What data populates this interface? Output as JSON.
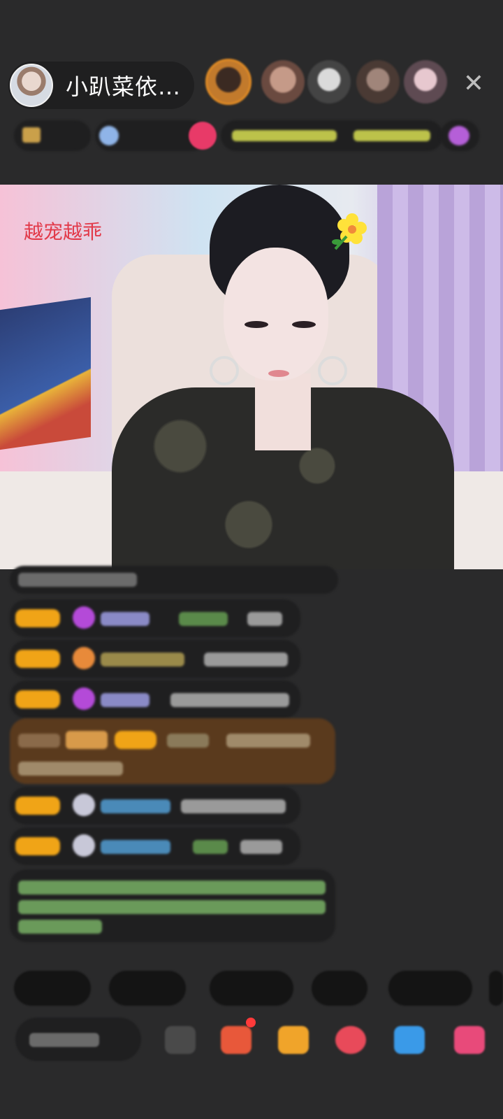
{
  "header": {
    "host_name": "小趴菜依…",
    "close_icon": "close-icon"
  },
  "stream": {
    "caption": "越宠越乖"
  },
  "colors": {
    "background": "#2a2a2b",
    "badge": "#f0a417",
    "caption": "#e23a4a"
  }
}
